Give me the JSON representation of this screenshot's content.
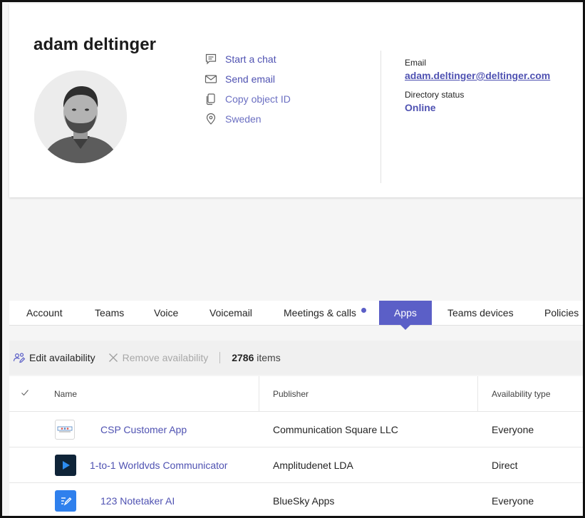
{
  "profile": {
    "name": "adam deltinger",
    "actions": [
      {
        "label": "Start a chat",
        "icon": "chat-icon"
      },
      {
        "label": "Send email",
        "icon": "mail-icon"
      },
      {
        "label": "Copy object ID",
        "icon": "copy-icon"
      },
      {
        "label": "Sweden",
        "icon": "location-icon"
      }
    ],
    "email_label": "Email",
    "email": "adam.deltinger@deltinger.com",
    "directory_status_label": "Directory status",
    "directory_status": "Online"
  },
  "tabs": [
    {
      "label": "Account"
    },
    {
      "label": "Teams"
    },
    {
      "label": "Voice"
    },
    {
      "label": "Voicemail"
    },
    {
      "label": "Meetings & calls",
      "indicator": true
    },
    {
      "label": "Apps",
      "active": true
    },
    {
      "label": "Teams devices"
    },
    {
      "label": "Policies"
    }
  ],
  "toolbar": {
    "edit_availability": "Edit availability",
    "remove_availability": "Remove availability",
    "item_count": "2786",
    "items_label": "items"
  },
  "table": {
    "columns": [
      "Name",
      "Publisher",
      "Availability type"
    ],
    "rows": [
      {
        "name": "CSP Customer App",
        "publisher": "Communication Square LLC",
        "availability": "Everyone",
        "icon": "csp-logo-icon"
      },
      {
        "name": "1-to-1 Worldvds Communicator",
        "publisher": "Amplitudenet LDA",
        "availability": "Direct",
        "icon": "play-icon"
      },
      {
        "name": "123 Notetaker AI",
        "publisher": "BlueSky Apps",
        "availability": "Everyone",
        "icon": "notetaker-icon"
      }
    ]
  },
  "colors": {
    "accent": "#5b5fc7",
    "link": "#4f52b2"
  }
}
